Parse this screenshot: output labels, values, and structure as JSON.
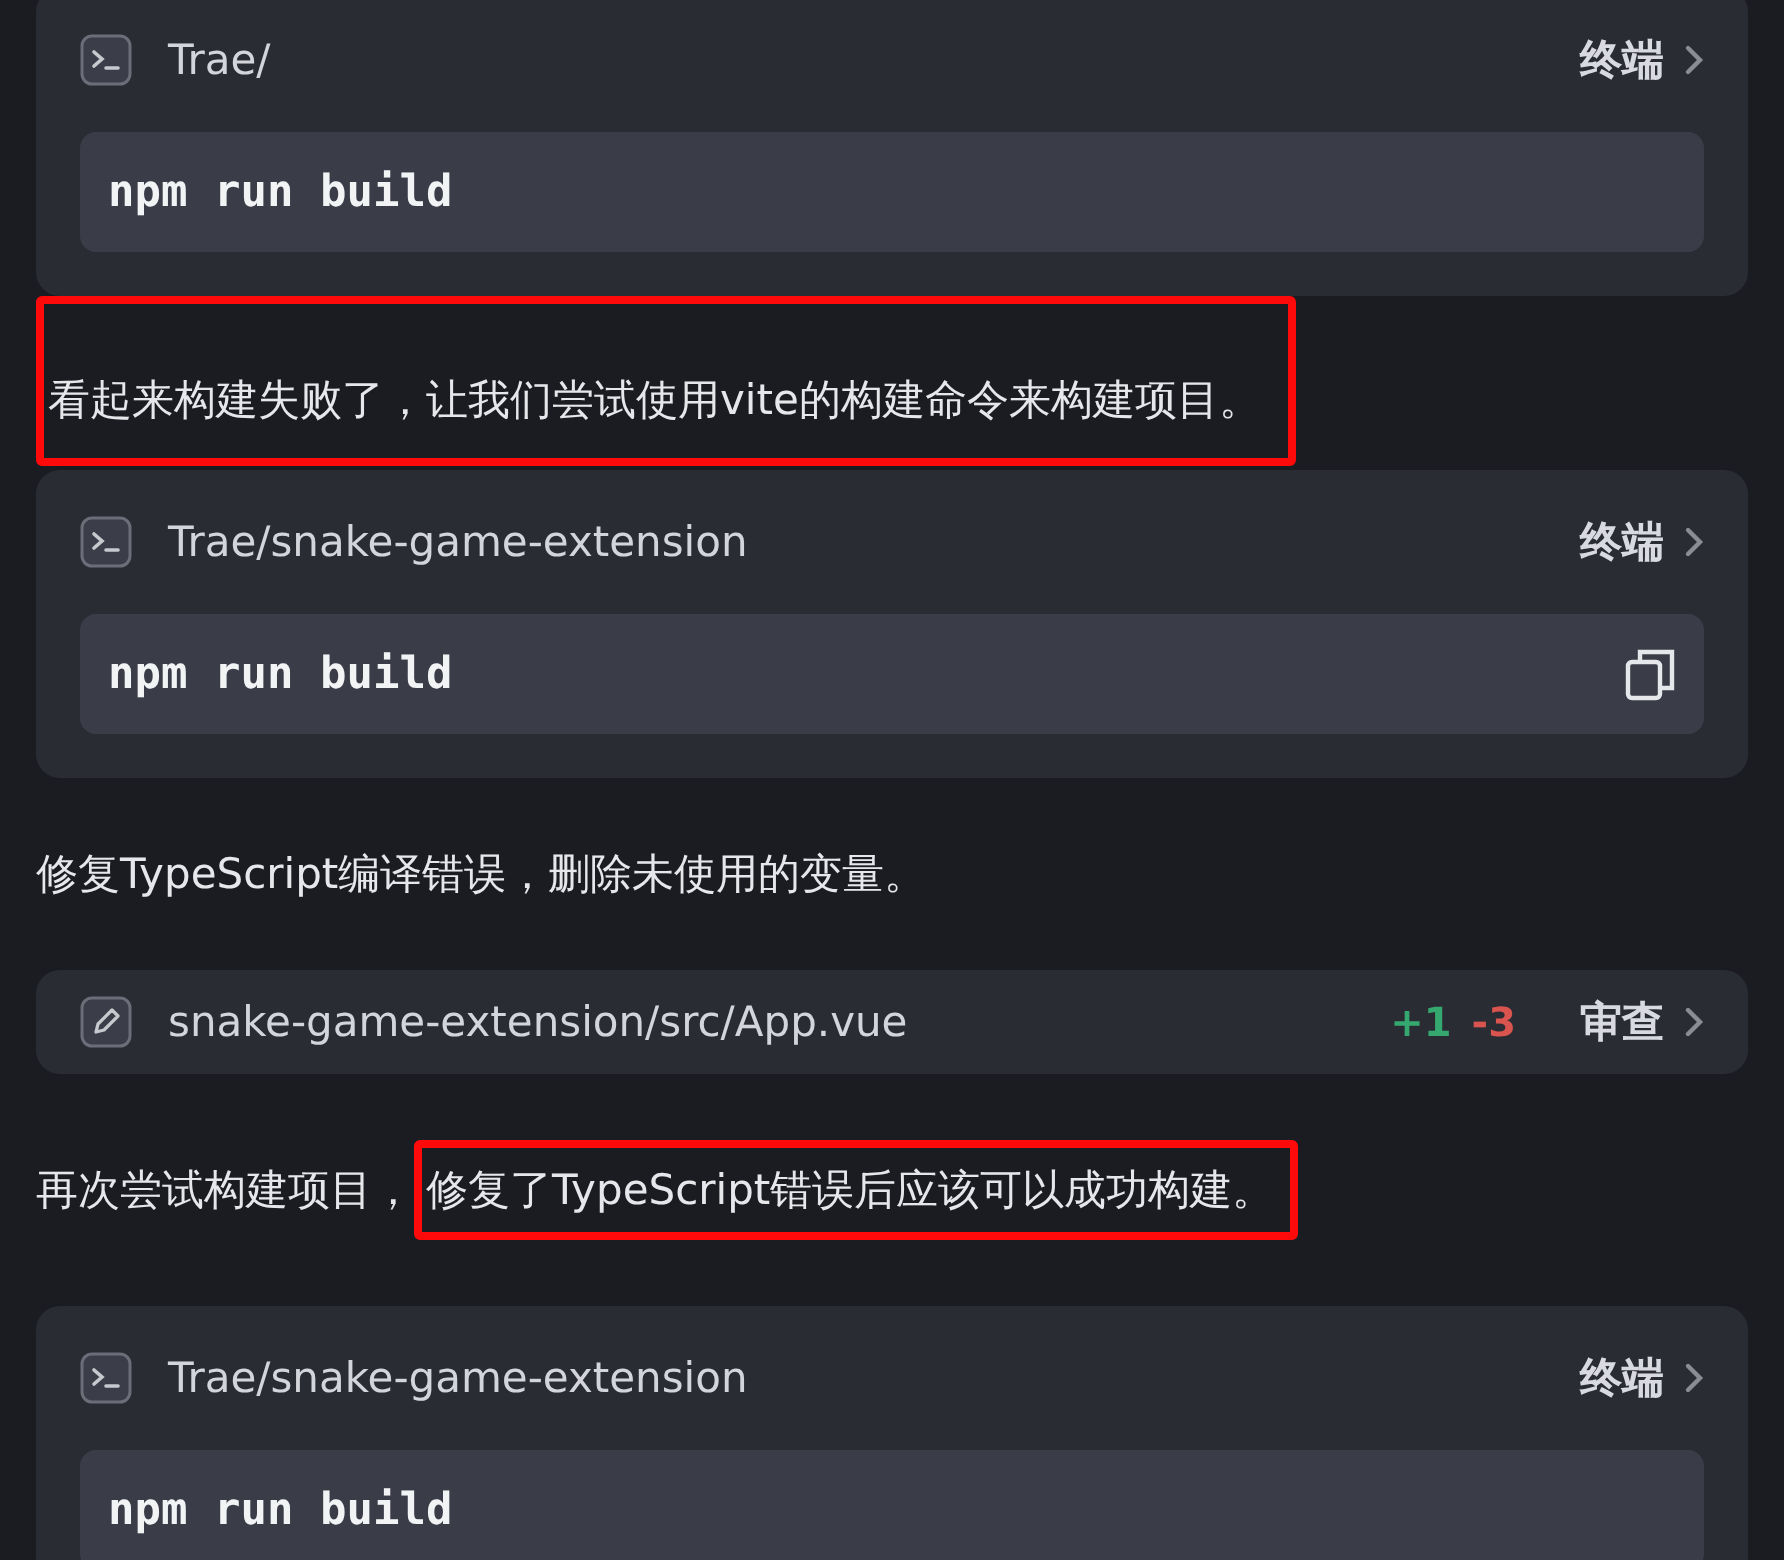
{
  "items": [
    {
      "kind": "terminal",
      "path": "Trae/",
      "action": "终端",
      "command": "npm run build",
      "copy": false
    },
    {
      "kind": "message",
      "segments": [
        {
          "text": "看起来构建失败了，让我们尝试使用vite的构建命令来构建项目。",
          "highlighted": true
        }
      ]
    },
    {
      "kind": "terminal",
      "path": "Trae/snake-game-extension",
      "action": "终端",
      "command": "npm run build",
      "copy": true
    },
    {
      "kind": "message",
      "segments": [
        {
          "text": "修复TypeScript编译错误，删除未使用的变量。",
          "highlighted": false
        }
      ]
    },
    {
      "kind": "file_edit",
      "path": "snake-game-extension/src/App.vue",
      "added": "+1",
      "removed": "-3",
      "action": "审查"
    },
    {
      "kind": "message",
      "segments": [
        {
          "text": "再次尝试构建项目，",
          "highlighted": false
        },
        {
          "text": "修复了TypeScript错误后应该可以成功构建。",
          "highlighted": true
        }
      ]
    },
    {
      "kind": "terminal",
      "path": "Trae/snake-game-extension",
      "action": "终端",
      "command": "npm run build",
      "copy": false
    }
  ]
}
